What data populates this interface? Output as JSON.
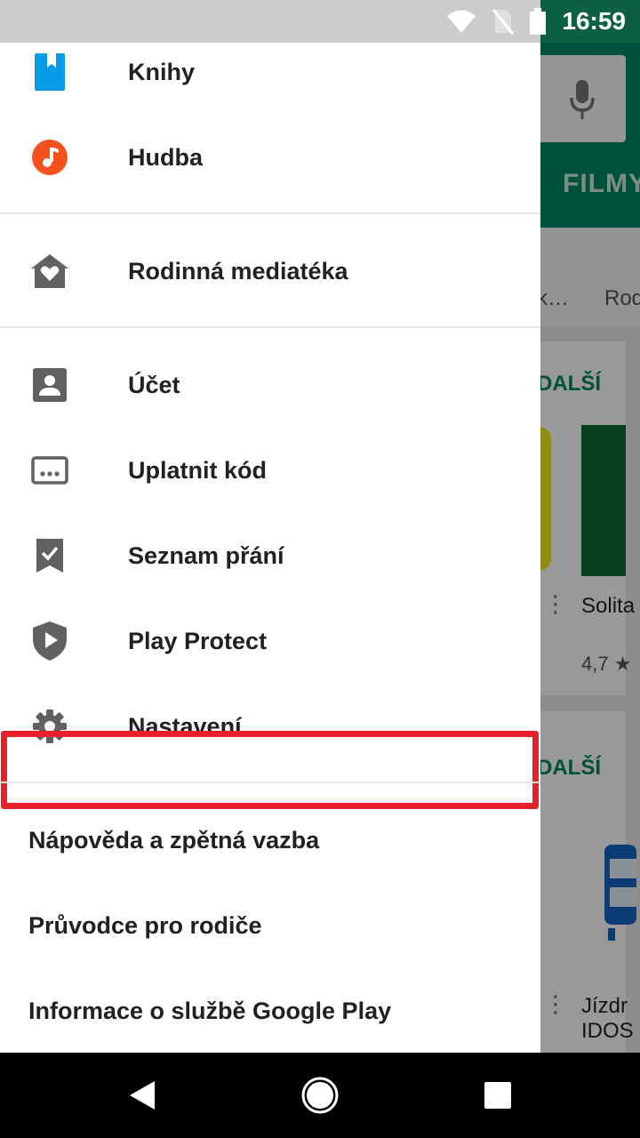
{
  "status_bar": {
    "time": "16:59",
    "icons": [
      "wifi-icon",
      "no-sim-icon",
      "battery-icon"
    ]
  },
  "background": {
    "tab_label": "FILMY",
    "chip_labels": [
      "k…",
      "Rod"
    ],
    "more_label": "DALŠÍ",
    "card_titles": [
      "Solita",
      "Jízdr",
      "IDOS"
    ],
    "rating": "4,7 ★"
  },
  "drawer": {
    "items_top": [
      {
        "label": "Knihy",
        "icon": "books-icon"
      },
      {
        "label": "Hudba",
        "icon": "music-icon"
      }
    ],
    "family": {
      "label": "Rodinná mediatéka",
      "icon": "family-library-icon"
    },
    "items_account": [
      {
        "label": "Účet",
        "icon": "account-icon"
      },
      {
        "label": "Uplatnit kód",
        "icon": "redeem-icon"
      },
      {
        "label": "Seznam přání",
        "icon": "wishlist-icon"
      },
      {
        "label": "Play Protect",
        "icon": "play-protect-icon"
      },
      {
        "label": "Nastavení",
        "icon": "settings-icon"
      }
    ],
    "footer": [
      {
        "label": "Nápověda a zpětná vazba"
      },
      {
        "label": "Průvodce pro rodiče"
      },
      {
        "label": "Informace o službě Google Play"
      }
    ],
    "highlight_color": "#e8202a"
  },
  "nav_bar": {
    "buttons": [
      "back-icon",
      "home-icon",
      "recents-icon"
    ]
  },
  "colors": {
    "play_green": "#01875f",
    "books_blue": "#039be5",
    "music_orange": "#ef6c00"
  }
}
